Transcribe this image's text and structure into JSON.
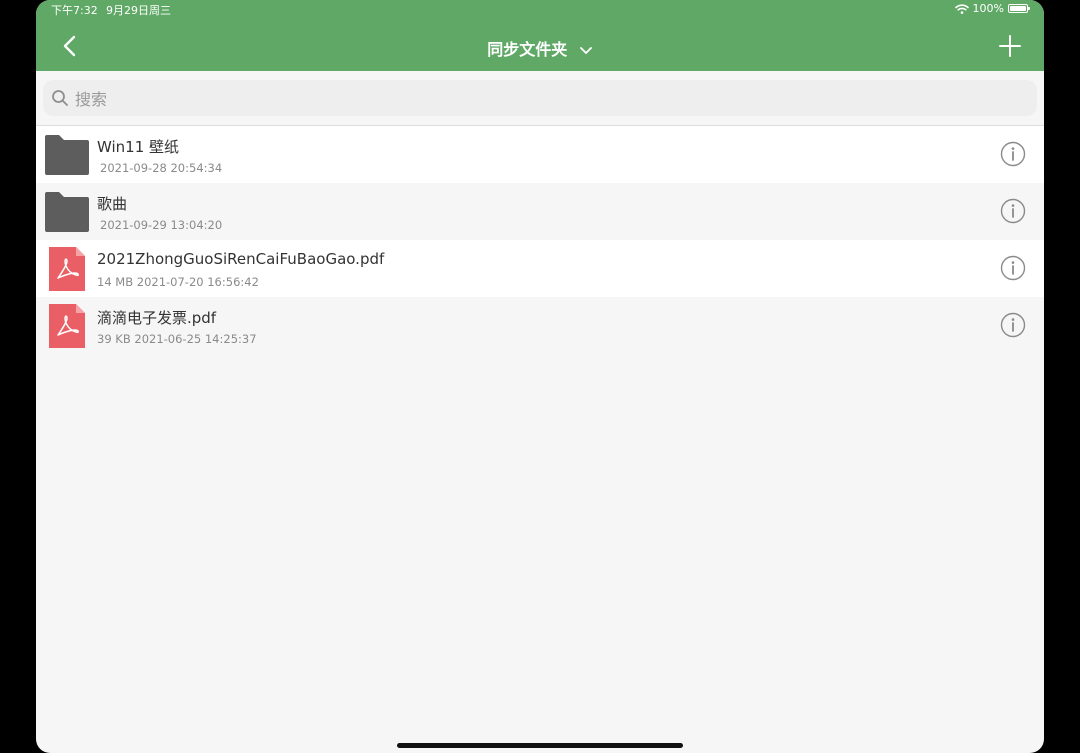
{
  "status_bar": {
    "time": "下午7:32",
    "date": "9月29日周三",
    "battery": "100%"
  },
  "nav": {
    "title": "同步文件夹"
  },
  "search": {
    "placeholder": "搜索"
  },
  "files": [
    {
      "name": "Win11 壁纸",
      "meta": "2021-09-28 20:54:34",
      "type": "folder"
    },
    {
      "name": "歌曲",
      "meta": "2021-09-29 13:04:20",
      "type": "folder"
    },
    {
      "name": "2021ZhongGuoSiRenCaiFuBaoGao.pdf",
      "meta": "14 MB 2021-07-20 16:56:42",
      "type": "pdf"
    },
    {
      "name": "滴滴电子发票.pdf",
      "meta": "39 KB 2021-06-25 14:25:37",
      "type": "pdf"
    }
  ],
  "colors": {
    "header": "#5fa866",
    "folder": "#5d5d5d",
    "pdf": "#ea5f66"
  }
}
